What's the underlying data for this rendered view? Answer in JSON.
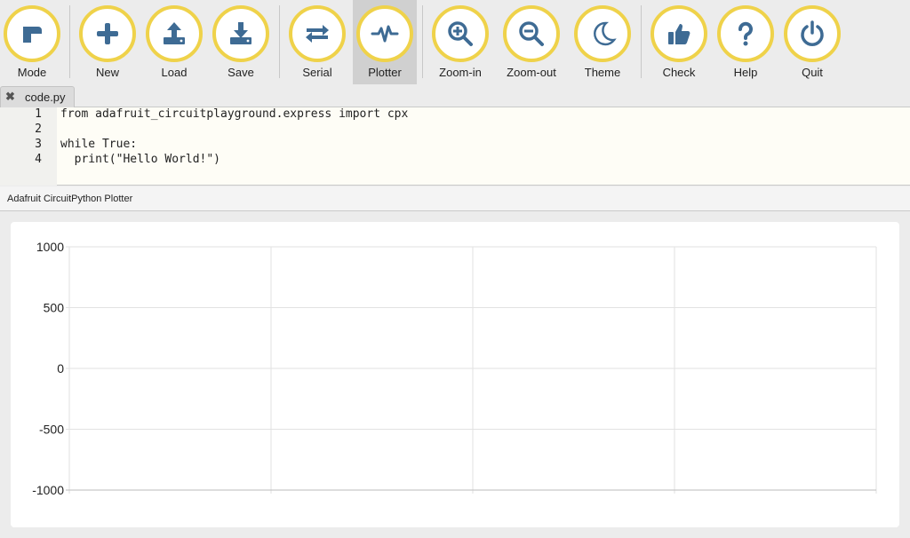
{
  "toolbar": {
    "buttons": [
      {
        "id": "mode",
        "label": "Mode",
        "icon": "mode-icon"
      },
      {
        "id": "new",
        "label": "New",
        "icon": "plus-icon"
      },
      {
        "id": "load",
        "label": "Load",
        "icon": "upload-icon"
      },
      {
        "id": "save",
        "label": "Save",
        "icon": "download-icon"
      },
      {
        "id": "serial",
        "label": "Serial",
        "icon": "swap-arrows-icon"
      },
      {
        "id": "plotter",
        "label": "Plotter",
        "icon": "pulse-icon",
        "active": true
      },
      {
        "id": "zoom-in",
        "label": "Zoom-in",
        "icon": "zoom-in-icon"
      },
      {
        "id": "zoom-out",
        "label": "Zoom-out",
        "icon": "zoom-out-icon"
      },
      {
        "id": "theme",
        "label": "Theme",
        "icon": "moon-icon"
      },
      {
        "id": "check",
        "label": "Check",
        "icon": "thumbs-up-icon"
      },
      {
        "id": "help",
        "label": "Help",
        "icon": "question-icon"
      },
      {
        "id": "quit",
        "label": "Quit",
        "icon": "power-icon"
      }
    ],
    "accent_color": "#efd24a",
    "icon_color": "#3e6b94"
  },
  "tab": {
    "close_symbol": "✖",
    "filename": "code.py"
  },
  "editor": {
    "lines": [
      {
        "number": "1",
        "text": "from adafruit_circuitplayground.express import cpx"
      },
      {
        "number": "2",
        "text": ""
      },
      {
        "number": "3",
        "text": "while True:"
      },
      {
        "number": "4",
        "text": "  print(\"Hello World!\")"
      }
    ]
  },
  "plotter": {
    "title": "Adafruit CircuitPython Plotter",
    "chart_data": {
      "type": "line",
      "series": [],
      "y_ticks": [
        "1000",
        "500",
        "0",
        "-500",
        "-1000"
      ],
      "ylim": [
        -1000,
        1000
      ],
      "grid": true
    }
  }
}
